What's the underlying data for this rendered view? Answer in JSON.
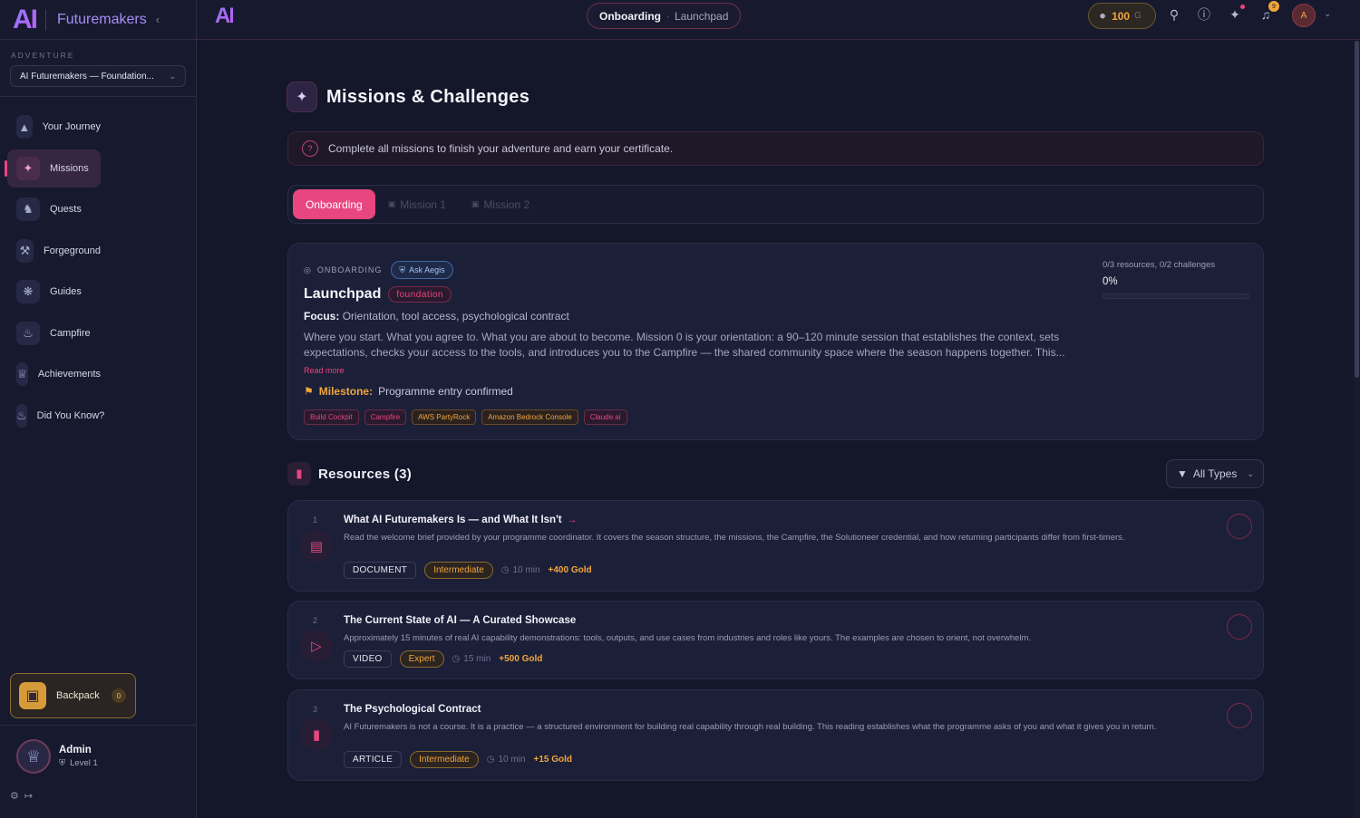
{
  "sidebar": {
    "logo": "AI",
    "brand": "Futuremakers",
    "collapse_icon": "chevron-left-icon",
    "adventure_label": "ADVENTURE",
    "adventure_selected": "AI Futuremakers — Foundation...",
    "nav": [
      {
        "label": "Your Journey",
        "icon": "mountain-icon",
        "active": false
      },
      {
        "label": "Missions",
        "icon": "drone-icon",
        "active": true
      },
      {
        "label": "Quests",
        "icon": "horse-icon",
        "active": false
      },
      {
        "label": "Forgeground",
        "icon": "hammer-icon",
        "active": false
      },
      {
        "label": "Guides",
        "icon": "compass-icon",
        "active": false
      },
      {
        "label": "Campfire",
        "icon": "lantern-icon",
        "active": false
      },
      {
        "label": "Achievements",
        "icon": "crown-icon",
        "active": false
      },
      {
        "label": "Did You Know?",
        "icon": "cake-icon",
        "active": false
      }
    ],
    "backpack": {
      "label": "Backpack",
      "count": "0"
    },
    "user": {
      "name": "Admin",
      "level": "Level 1"
    }
  },
  "topbar": {
    "logo": "AI",
    "breadcrumb": {
      "current": "Onboarding",
      "sub": "Launchpad"
    },
    "gold": {
      "value": "100",
      "unit": "G"
    },
    "notifications_count": "9"
  },
  "page": {
    "title": "Missions & Challenges",
    "info": "Complete all missions to finish your adventure and earn your certificate.",
    "tabs": [
      {
        "label": "Onboarding",
        "active": true,
        "locked": false
      },
      {
        "label": "Mission 1",
        "active": false,
        "locked": true
      },
      {
        "label": "Mission 2",
        "active": false,
        "locked": true
      }
    ]
  },
  "mission": {
    "eyebrow": "ONBOARDING",
    "aegis_label": "Ask Aegis",
    "title": "Launchpad",
    "tag": "foundation",
    "focus_label": "Focus:",
    "focus": "Orientation, tool access, psychological contract",
    "description": "Where you start. What you agree to. What you are about to become. Mission 0 is your orientation: a 90–120 minute session that establishes the context, sets expectations, checks your access to the tools, and introduces you to the Campfire — the shared community space where the season happens together. This...",
    "read_more": "Read more",
    "milestone_label": "Milestone:",
    "milestone": "Programme entry confirmed",
    "tools": [
      {
        "label": "Build Cockpit",
        "color": "pink"
      },
      {
        "label": "Campfire",
        "color": "pink"
      },
      {
        "label": "AWS PartyRock",
        "color": "amber"
      },
      {
        "label": "Amazon Bedrock Console",
        "color": "amber"
      },
      {
        "label": "Claude.ai",
        "color": "pink"
      }
    ],
    "progress_text": "0/3 resources, 0/2 challenges",
    "progress_pct": "0%",
    "progress_value": 0
  },
  "resources": {
    "title": "Resources (3)",
    "filter_label": "All Types",
    "items": [
      {
        "num": "1",
        "title": "What AI Futuremakers Is — and What It Isn't",
        "has_arrow": true,
        "icon": "document-icon",
        "description": "Read the welcome brief provided by your programme coordinator. It covers the season structure, the missions, the Campfire, the Solutioneer credential, and how returning participants differ from first-timers.",
        "type": "DOCUMENT",
        "level": "Intermediate",
        "duration": "10 min",
        "gold": "+400 Gold"
      },
      {
        "num": "2",
        "title": "The Current State of AI — A Curated Showcase",
        "has_arrow": false,
        "icon": "play-icon",
        "description": "Approximately 15 minutes of real AI capability demonstrations: tools, outputs, and use cases from industries and roles like yours. The examples are chosen to orient, not overwhelm.",
        "type": "VIDEO",
        "level": "Expert",
        "duration": "15 min",
        "gold": "+500 Gold"
      },
      {
        "num": "3",
        "title": "The Psychological Contract",
        "has_arrow": false,
        "icon": "book-icon",
        "description": "AI Futuremakers is not a course. It is a practice — a structured environment for building real capability through real building. This reading establishes what the programme asks of you and what it gives you in return.",
        "type": "ARTICLE",
        "level": "Intermediate",
        "duration": "10 min",
        "gold": "+15 Gold"
      }
    ]
  },
  "colors": {
    "accent": "#e8467f",
    "gold": "#f0a63a",
    "bg": "#14162a",
    "card": "#1c1f38"
  }
}
